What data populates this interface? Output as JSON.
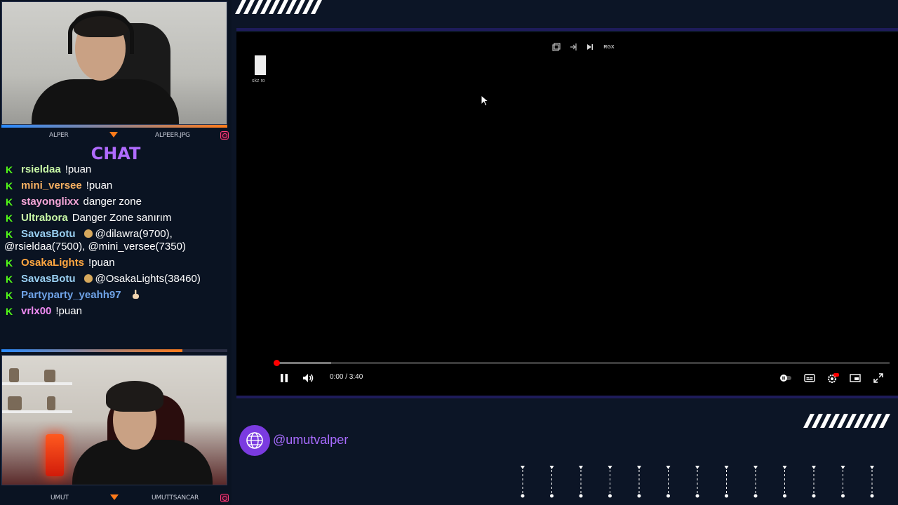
{
  "webcams": {
    "top": {
      "name_left": "ALPER",
      "name_right": "ALPEER.JPG"
    },
    "bottom": {
      "name_left": "UMUT",
      "name_right": "UMUTTSANCAR"
    }
  },
  "chat": {
    "title": "CHAT",
    "messages": [
      {
        "user": "rsieldaa",
        "color": "#c8f7a6",
        "text": "!puan",
        "bag": false,
        "hand": false
      },
      {
        "user": "mini_versee",
        "color": "#f7b062",
        "text": "!puan",
        "bag": false,
        "hand": false
      },
      {
        "user": "stayonglixx",
        "color": "#f5a6d7",
        "text": "danger zone",
        "bag": false,
        "hand": false
      },
      {
        "user": "Ultrabora",
        "color": "#c8f7a6",
        "text": "Danger Zone sanırım",
        "bag": false,
        "hand": false
      },
      {
        "user": "SavasBotu",
        "color": "#9ad0f2",
        "text": "@dilawra(9700), @rsieldaa(7500), @mini_versee(7350)",
        "bag": true,
        "hand": false
      },
      {
        "user": "OsakaLights",
        "color": "#ffa640",
        "text": "!puan",
        "bag": false,
        "hand": false
      },
      {
        "user": "SavasBotu",
        "color": "#9ad0f2",
        "text": "@OsakaLights(38460)",
        "bag": true,
        "hand": false
      },
      {
        "user": "Partyparty_yeahh97",
        "color": "#6fa3e8",
        "text": "",
        "bag": false,
        "hand": true
      },
      {
        "user": "vrlx00",
        "color": "#ef8bf2",
        "text": "!puan",
        "bag": false,
        "hand": false
      }
    ]
  },
  "video": {
    "desktop_file_label": "skz ro",
    "toolbar_text_button": "RGX",
    "time": "0:00 / 3:40",
    "played_fraction": 0.0,
    "buffered_fraction": 0.09
  },
  "social": {
    "handle": "@umutvalper"
  },
  "colors": {
    "accent": "#a86bff",
    "kick_green": "#53fc18",
    "bg": "#0c1526"
  }
}
